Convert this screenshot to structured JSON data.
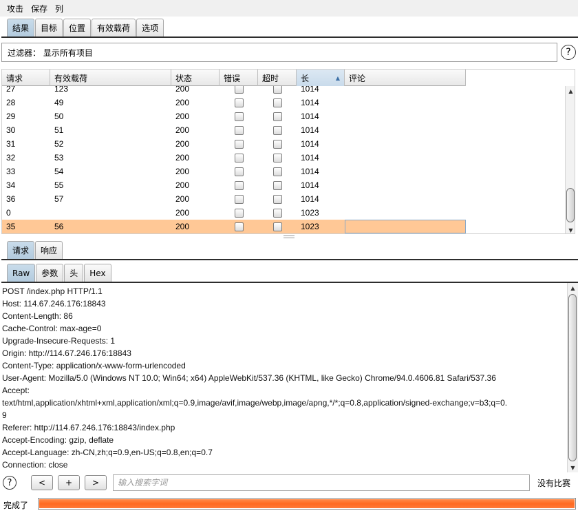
{
  "menu": [
    "攻击",
    "保存",
    "列"
  ],
  "main_tabs": [
    "结果",
    "目标",
    "位置",
    "有效载荷",
    "选项"
  ],
  "filter": {
    "label": "过滤器： 显示所有项目"
  },
  "help_symbol": "?",
  "table": {
    "columns": [
      "请求",
      "有效载荷",
      "状态",
      "错误",
      "超时",
      "长",
      "评论"
    ],
    "rows": [
      {
        "request": "27",
        "payload": "123",
        "status": "200",
        "length": "1014",
        "comment": ""
      },
      {
        "request": "28",
        "payload": "49",
        "status": "200",
        "length": "1014",
        "comment": ""
      },
      {
        "request": "29",
        "payload": "50",
        "status": "200",
        "length": "1014",
        "comment": ""
      },
      {
        "request": "30",
        "payload": "51",
        "status": "200",
        "length": "1014",
        "comment": ""
      },
      {
        "request": "31",
        "payload": "52",
        "status": "200",
        "length": "1014",
        "comment": ""
      },
      {
        "request": "32",
        "payload": "53",
        "status": "200",
        "length": "1014",
        "comment": ""
      },
      {
        "request": "33",
        "payload": "54",
        "status": "200",
        "length": "1014",
        "comment": ""
      },
      {
        "request": "34",
        "payload": "55",
        "status": "200",
        "length": "1014",
        "comment": ""
      },
      {
        "request": "36",
        "payload": "57",
        "status": "200",
        "length": "1014",
        "comment": ""
      },
      {
        "request": "0",
        "payload": "",
        "status": "200",
        "length": "1023",
        "comment": ""
      },
      {
        "request": "35",
        "payload": "56",
        "status": "200",
        "length": "1023",
        "comment": ""
      }
    ]
  },
  "detail_tabs": [
    "请求",
    "响应"
  ],
  "view_tabs": [
    "Raw",
    "参数",
    "头",
    "Hex"
  ],
  "raw_lines": [
    "POST /index.php HTTP/1.1",
    "Host: 114.67.246.176:18843",
    "Content-Length: 86",
    "Cache-Control: max-age=0",
    "Upgrade-Insecure-Requests: 1",
    "Origin: http://114.67.246.176:18843",
    "Content-Type: application/x-www-form-urlencoded",
    "User-Agent: Mozilla/5.0 (Windows NT 10.0; Win64; x64) AppleWebKit/537.36 (KHTML, like Gecko) Chrome/94.0.4606.81 Safari/537.36",
    "Accept:",
    "text/html,application/xhtml+xml,application/xml;q=0.9,image/avif,image/webp,image/apng,*/*;q=0.8,application/signed-exchange;v=b3;q=0.",
    "9",
    "Referer: http://114.67.246.176:18843/index.php",
    "Accept-Encoding: gzip, deflate",
    "Accept-Language: zh-CN,zh;q=0.9,en-US;q=0.8,en;q=0.7",
    "Connection: close"
  ],
  "search": {
    "prev_label": "<",
    "add_label": "+",
    "next_label": ">",
    "placeholder": "输入搜索字词",
    "match_text": "没有比赛"
  },
  "status": {
    "text": "完成了",
    "progress": 1.0,
    "progress_color": "#ff7432"
  },
  "colors": {
    "selected_row": "#ffc896",
    "active_tab": "#b9cfe2"
  }
}
